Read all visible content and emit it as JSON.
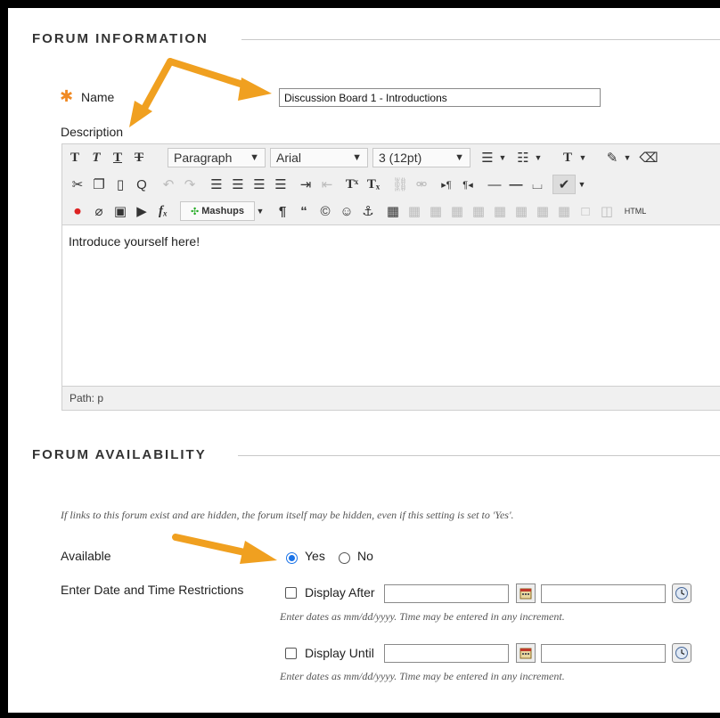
{
  "forum_information": {
    "heading": "FORUM INFORMATION",
    "name_label": "Name",
    "required_mark": "✱",
    "name_value": "Discussion Board 1 - Introductions",
    "description_label": "Description"
  },
  "editor": {
    "row1": {
      "format_select": "Paragraph",
      "font_select": "Arial",
      "size_select": "3 (12pt)"
    },
    "mashups_label": "Mashups",
    "html_label": "HTML",
    "content": "Introduce yourself here!",
    "path_label": "Path: p"
  },
  "forum_availability": {
    "heading": "FORUM AVAILABILITY",
    "note": "If links to this forum exist and are hidden, the forum itself may be hidden, even if this setting is set to 'Yes'.",
    "available_label": "Available",
    "yes_label": "Yes",
    "no_label": "No",
    "selected": "Yes",
    "date_restrictions_label": "Enter Date and Time Restrictions",
    "display_after_label": "Display After",
    "display_until_label": "Display Until",
    "date_hint": "Enter dates as mm/dd/yyyy. Time may be entered in any increment.",
    "display_after_date": "",
    "display_after_time": "",
    "display_until_date": "",
    "display_until_time": ""
  },
  "colors": {
    "arrow": "#f0a020",
    "required": "#f08a24",
    "radio_selected": "#1a73e8"
  },
  "icons": [
    "bold-icon",
    "italic-icon",
    "underline-icon",
    "strikethrough-icon",
    "bullet-list-icon",
    "numbered-list-icon",
    "text-color-icon",
    "highlight-icon",
    "eraser-icon",
    "cut-icon",
    "copy-icon",
    "paste-icon",
    "find-icon",
    "undo-icon",
    "redo-icon",
    "align-left-icon",
    "align-center-icon",
    "align-right-icon",
    "justify-icon",
    "indent-icon",
    "outdent-icon",
    "superscript-icon",
    "subscript-icon",
    "link-icon",
    "unlink-icon",
    "ltr-icon",
    "rtl-icon",
    "horizontal-rule-icon",
    "spellcheck-icon",
    "record-icon",
    "attach-icon",
    "image-icon",
    "media-icon",
    "math-icon",
    "paragraph-mark-icon",
    "quote-icon",
    "copyright-icon",
    "emoticon-icon",
    "anchor-icon",
    "table-icon",
    "calendar-icon",
    "clock-icon"
  ]
}
